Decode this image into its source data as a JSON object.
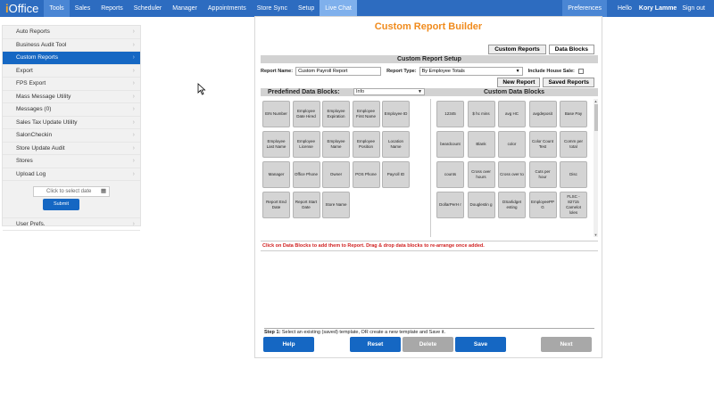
{
  "app": {
    "logo_i": "i",
    "logo_rest": "Office"
  },
  "nav": [
    "Tools",
    "Sales",
    "Reports",
    "Scheduler",
    "Manager",
    "Appointments",
    "Store Sync",
    "Setup",
    "Live Chat"
  ],
  "topright": {
    "prefs": "Preferences",
    "greeting_prefix": "Hello",
    "user_name": "Kory Lamme",
    "signout": "Sign out"
  },
  "sidebar": {
    "items": [
      {
        "label": "Auto Reports",
        "active": false
      },
      {
        "label": "Business Audit Tool",
        "active": false
      },
      {
        "label": "Custom Reports",
        "active": true
      },
      {
        "label": "Export",
        "active": false
      },
      {
        "label": "FPS Export",
        "active": false
      },
      {
        "label": "Mass Message Utility",
        "active": false
      },
      {
        "label": "Messages (0)",
        "active": false
      },
      {
        "label": "Sales Tax Update Utility",
        "active": false
      },
      {
        "label": "SalonCheckin",
        "active": false
      },
      {
        "label": "Store Update Audit",
        "active": false
      },
      {
        "label": "Stores",
        "active": false
      },
      {
        "label": "Upload Log",
        "active": false
      }
    ],
    "date_placeholder": "Click to select date",
    "submit": "Submit",
    "user_prefs": "User Prefs."
  },
  "builder": {
    "title": "Custom Report Builder",
    "tabs": [
      "Custom Reports",
      "Data Blocks"
    ],
    "setup_title": "Custom Report Setup",
    "report_name_label": "Report Name:",
    "report_name_value": "Custom Payroll Report",
    "report_type_label": "Report Type:",
    "report_type_value": "By Employee Totals",
    "house_sale_label": "Include House Sale:",
    "new_report": "New Report",
    "saved_reports": "Saved Reports",
    "predefined_label": "Predefined Data Blocks:",
    "predefined_select": "Info",
    "custom_label": "Custom Data Blocks",
    "instruction": "Click on Data Blocks to add them to Report. Drag & drop data blocks to re-arrange once added.",
    "step_label": "Step 1:",
    "step_text": "Select an existing (saved) template, OR create a new template and Save it.",
    "buttons": {
      "help": "Help",
      "reset": "Reset",
      "delete": "Delete",
      "save": "Save",
      "next": "Next"
    }
  },
  "predefined_blocks": [
    "EIN Number",
    "Employee Date Hired",
    "Employee Expiration",
    "Employee First Name",
    "Employee ID",
    "Employee Last Name",
    "Employee License",
    "Employee Name",
    "Employee Position",
    "Location Name",
    "Manager",
    "Office Phone",
    "Owner",
    "POS Phone",
    "Payroll ID",
    "Report End Date",
    "Report Start Date",
    "Store Name"
  ],
  "custom_blocks": [
    "12345",
    "$ hc mins",
    "avg HC",
    "avgdeposit",
    "Base Pay",
    "beardcount",
    "Blank",
    "color",
    "Color Count Test",
    "Comm per total",
    "counts",
    "Cross over hours",
    "Cross over to",
    "Cuts per hour",
    "Disc",
    "DollarPerH r",
    "Douglestin g",
    "DSarlidget esting",
    "EmployeePP G",
    "FLSC - 82715 Camelot loles"
  ]
}
